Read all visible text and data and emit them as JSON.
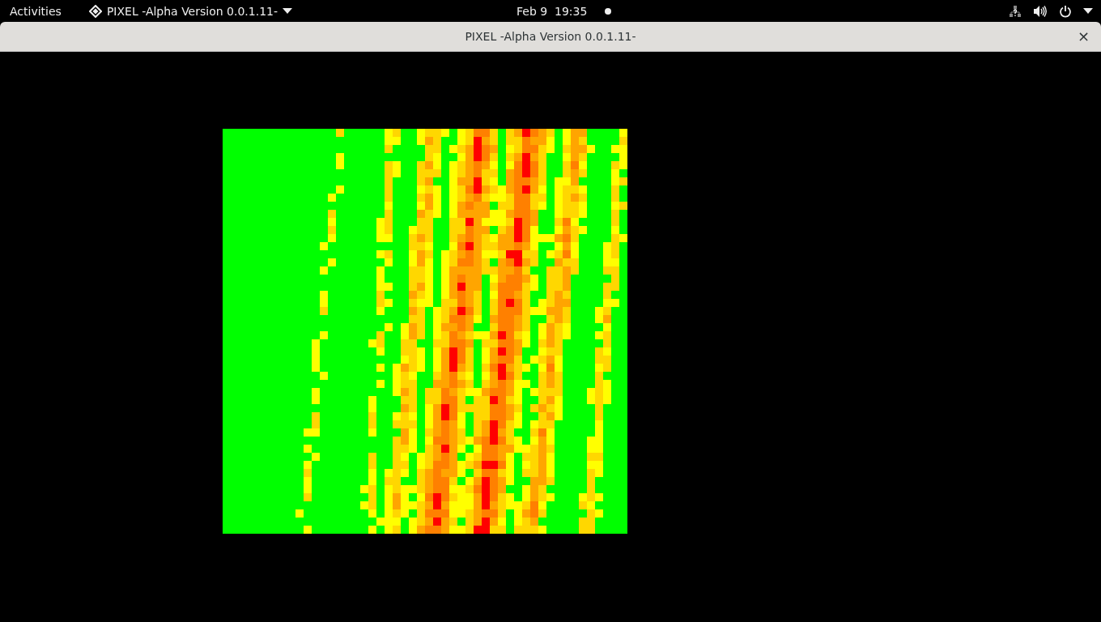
{
  "top_bar": {
    "activities": "Activities",
    "app_menu": "PIXEL -Alpha Version 0.0.1.11-",
    "clock": "Feb 9  19:35"
  },
  "window": {
    "title": "PIXEL -Alpha Version 0.0.1.11-",
    "close": "×"
  }
}
